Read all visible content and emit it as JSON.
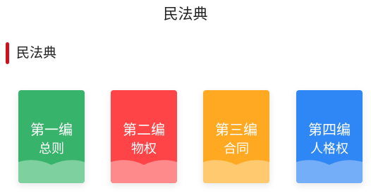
{
  "page": {
    "title": "民法典"
  },
  "section": {
    "title": "民法典",
    "accent": "#d0101e"
  },
  "books": [
    {
      "part": "第一编",
      "name": "总则",
      "color": "#37b36b",
      "pages_color": "#7fd09f"
    },
    {
      "part": "第二编",
      "name": "物权",
      "color": "#ff4447",
      "pages_color": "#ff8a8c"
    },
    {
      "part": "第三编",
      "name": "合同",
      "color": "#ffa822",
      "pages_color": "#ffc96f"
    },
    {
      "part": "第四编",
      "name": "人格权",
      "color": "#2f86f5",
      "pages_color": "#74aef8"
    }
  ]
}
